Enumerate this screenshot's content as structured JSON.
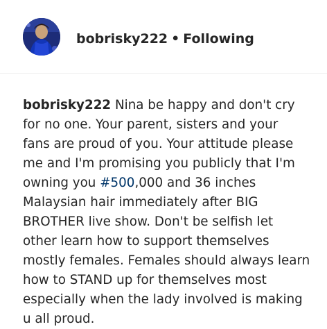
{
  "header": {
    "username": "bobrisky222",
    "separator": "•",
    "follow_status": "Following",
    "avatar_icon": "profile-avatar"
  },
  "caption": {
    "username": "bobrisky222",
    "lines": [
      "Nina be happy and don't cry",
      "for no one. Your parent, sisters and your",
      "fans are proud of you. Your attitude please",
      "me and I'm promising you publicly that I'm",
      "owning you ",
      "Malaysian hair immediately after BIG",
      "BROTHER live show. Don't be selfish let",
      "other learn how to support themselves",
      "mostly females. Females should always learn",
      "how to STAND up for themselves most",
      "especially when the lady involved is making",
      "u all proud."
    ],
    "hashtag": "#500",
    "after_hashtag": ",000 and 36 inches"
  },
  "colors": {
    "text": "#262626",
    "hashtag": "#003569",
    "divider": "#efefef"
  }
}
